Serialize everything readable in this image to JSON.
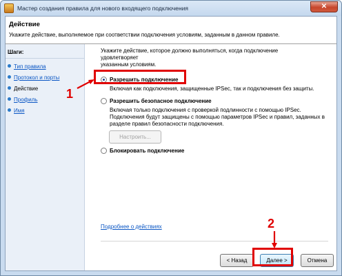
{
  "window": {
    "title": "Мастер создания правила для нового входящего подключения",
    "close_symbol": "✕"
  },
  "header": {
    "title": "Действие",
    "description": "Укажите действие, выполняемое при соответствии подключения условиям, заданным в данном правиле."
  },
  "sidebar": {
    "label": "Шаги:",
    "items": [
      {
        "label": "Тип правила",
        "state": "done"
      },
      {
        "label": "Протокол и порты",
        "state": "done"
      },
      {
        "label": "Действие",
        "state": "current"
      },
      {
        "label": "Профиль",
        "state": "pending"
      },
      {
        "label": "Имя",
        "state": "pending"
      }
    ]
  },
  "main": {
    "intro_line1": "Укажите действие, которое должно выполняться, когда подключение удовлетворяет",
    "intro_line2": "указанным условиям.",
    "options": [
      {
        "label": "Разрешить подключение",
        "desc_lines": [
          "Включая как подключения, защищенные IPSec, так и подключения без защиты."
        ],
        "selected": true
      },
      {
        "label": "Разрешить безопасное подключение",
        "desc_lines": [
          "Включая только подключения с проверкой подлинности с помощью IPSec.",
          "Подключения будут защищены с помощью параметров IPSec и правил, заданных в",
          "разделе правил безопасности подключения."
        ],
        "button_label": "Настроить...",
        "selected": false
      },
      {
        "label": "Блокировать подключение",
        "selected": false
      }
    ],
    "learn_more_link": "Подробнее о действиях"
  },
  "footer": {
    "back_label": "< Назад",
    "next_label": "Далее >",
    "cancel_label": "Отмена"
  },
  "annotations": {
    "marker1": "1",
    "marker2": "2",
    "color": "#e00000"
  }
}
